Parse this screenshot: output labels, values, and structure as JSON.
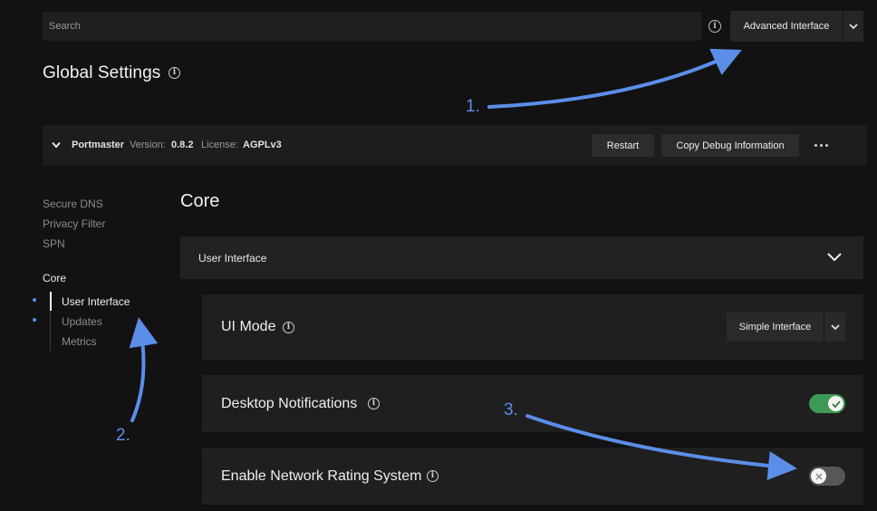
{
  "search": {
    "placeholder": "Search"
  },
  "header": {
    "info_glyph": "i",
    "interface_mode_label": "Advanced Interface",
    "page_title": "Global Settings"
  },
  "portmaster": {
    "name": "Portmaster",
    "version_label": "Version:",
    "version": "0.8.2",
    "license_label": "License:",
    "license": "AGPLv3",
    "restart_label": "Restart",
    "debug_label": "Copy Debug Information"
  },
  "sidebar": {
    "items": [
      "Secure DNS",
      "Privacy Filter",
      "SPN"
    ],
    "section": "Core",
    "sub_items": [
      "User Interface",
      "Updates",
      "Metrics"
    ]
  },
  "content": {
    "section_title": "Core",
    "group_label": "User Interface",
    "settings": [
      {
        "label": "UI Mode",
        "value": "Simple Interface"
      },
      {
        "label": "Desktop Notifications",
        "enabled": true
      },
      {
        "label": "Enable Network Rating System",
        "enabled": false
      }
    ]
  },
  "annotations": [
    "1.",
    "2.",
    "3."
  ],
  "colors": {
    "background": "#121212",
    "accent_blue": "#5b8ee8",
    "toggle_on": "#3c9a55",
    "toggle_off": "#575757"
  },
  "icons": [
    "info-icon",
    "chevron-down-icon",
    "more-icon",
    "check-icon",
    "x-icon",
    "arrow-icon"
  ]
}
